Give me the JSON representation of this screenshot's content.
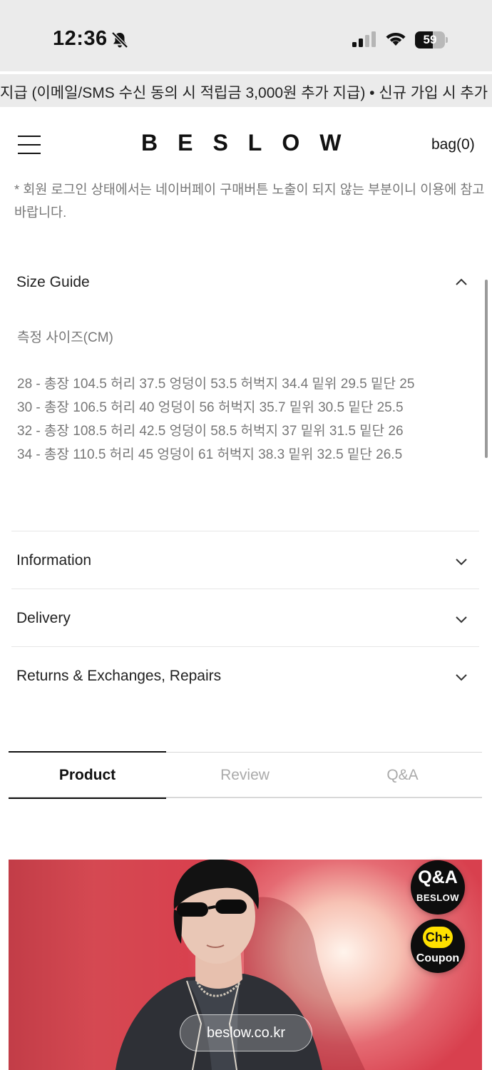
{
  "status_bar": {
    "time": "12:36",
    "battery_percent": 59,
    "battery_label": "59",
    "icons": [
      "bell-slash-icon",
      "cellular-signal-icon",
      "wifi-icon",
      "battery-icon"
    ]
  },
  "marquee": {
    "text": "지급 (이메일/SMS 수신 동의 시 적립금 3,000원 추가 지급) • 신규 가입 시 추가 "
  },
  "header": {
    "logo": "BESLOW",
    "bag_label": "bag(0)",
    "menu_icon": "hamburger-menu-icon"
  },
  "notice": {
    "text": "* 회원 로그인 상태에서는 네이버페이 구매버튼 노출이 되지 않는 부분이니 이용에 참고바랍니다."
  },
  "size_guide": {
    "title": "Size Guide",
    "subtitle": "측정 사이즈(CM)",
    "rows": [
      "28 - 총장 104.5 허리 37.5 엉덩이 53.5 허벅지 34.4 밑위 29.5 밑단 25",
      "30 - 총장 106.5 허리 40 엉덩이 56 허벅지 35.7 밑위 30.5 밑단 25.5",
      "32 - 총장 108.5 허리 42.5 엉덩이 58.5 허벅지 37 밑위 31.5 밑단 26",
      "34 - 총장 110.5 허리 45 엉덩이 61 허벅지 38.3 밑위 32.5 밑단 26.5"
    ]
  },
  "accordions": [
    {
      "title": "Information"
    },
    {
      "title": "Delivery"
    },
    {
      "title": "Returns & Exchanges, Repairs"
    }
  ],
  "tabs": [
    {
      "label": "Product",
      "active": true
    },
    {
      "label": "Review",
      "active": false
    },
    {
      "label": "Q&A",
      "active": false
    }
  ],
  "hero": {
    "url_label": "beslow.co.kr"
  },
  "floating": {
    "qa_title": "Q&A",
    "qa_sub": "BESLOW",
    "ch_label": "Ch+",
    "coupon_label": "Coupon"
  },
  "colors": {
    "accent_text": "#111111",
    "muted_text": "#777777",
    "hero_red": "#d8404e",
    "coupon_yellow": "#ffe100"
  }
}
